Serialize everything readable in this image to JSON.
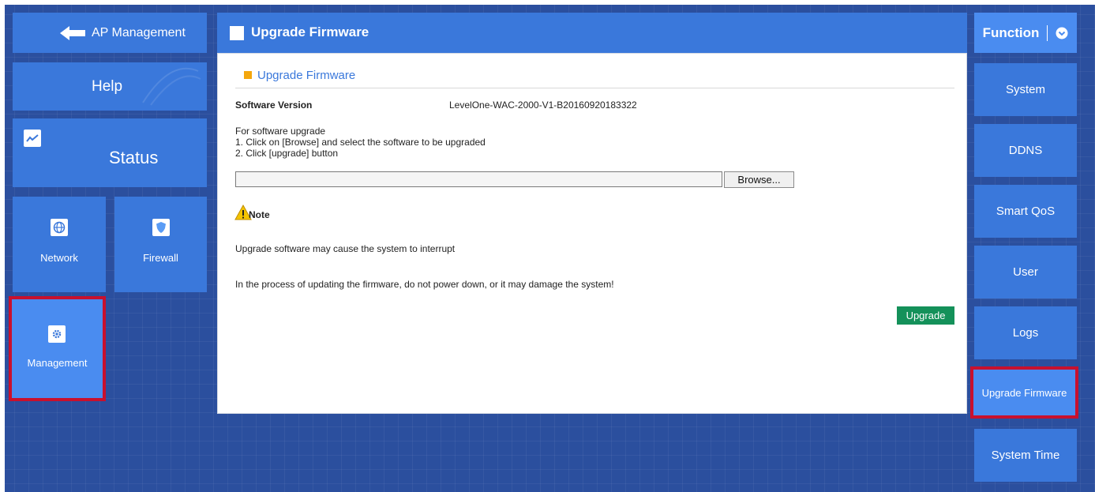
{
  "nav": {
    "back_label": "AP Management",
    "help_label": "Help",
    "status_label": "Status",
    "network_label": "Network",
    "firewall_label": "Firewall",
    "management_label": "Management"
  },
  "main": {
    "header_title": "Upgrade Firmware",
    "section_title": "Upgrade Firmware",
    "software_version_label": "Software Version",
    "software_version_value": "LevelOne-WAC-2000-V1-B20160920183322",
    "instructions": [
      "For software upgrade",
      "1. Click on [Browse] and select the software to be upgraded",
      "2. Click [upgrade] button"
    ],
    "browse_label": "Browse...",
    "note_label": "Note",
    "note_line1": "Upgrade software may cause the system to interrupt",
    "note_line2": "In the process of updating the firmware, do not power down, or it may damage the system!",
    "upgrade_label": "Upgrade"
  },
  "function_menu": {
    "title": "Function",
    "items": [
      "System",
      "DDNS",
      "Smart QoS",
      "User",
      "Logs",
      "Upgrade Firmware",
      "System Time"
    ]
  },
  "colors": {
    "accent_blue": "#3a78db",
    "highlight_red": "#c8102e",
    "upgrade_green": "#14915a",
    "orange_marker": "#f4a70d"
  }
}
